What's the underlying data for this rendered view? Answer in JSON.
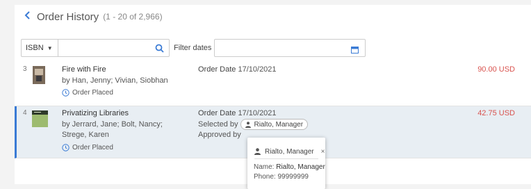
{
  "header": {
    "title": "Order History",
    "count": "(1 - 20 of 2,966)"
  },
  "filter": {
    "field_select": "ISBN",
    "search_value": "",
    "date_label": "Filter dates",
    "date_value": ""
  },
  "orders": [
    {
      "index": "3",
      "title": "Fire with Fire",
      "authors": "by Han, Jenny; Vivian, Siobhan",
      "status": "Order Placed",
      "order_date_label": "Order Date",
      "order_date": "17/10/2021",
      "price": "90.00 USD"
    },
    {
      "index": "4",
      "title": "Privatizing Libraries",
      "authors": "by Jerrard, Jane; Bolt, Nancy; Strege, Karen",
      "status": "Order Placed",
      "order_date_label": "Order Date",
      "order_date": "17/10/2021",
      "selected_by_label": "Selected by",
      "selected_by": "Rialto, Manager",
      "approved_by_label": "Approved by",
      "price": "42.75 USD"
    }
  ],
  "popup": {
    "name_header": "Rialto, Manager",
    "close": "×",
    "name_label": "Name:",
    "name_value": "Rialto, Manager",
    "phone_label": "Phone:",
    "phone_value": "99999999"
  },
  "colors": {
    "accent": "#3a7bd5",
    "price": "#d9534f",
    "selected_row": "#e8eef3"
  },
  "icons": [
    "chevron-left-icon",
    "search-icon",
    "calendar-icon",
    "clock-icon",
    "person-icon",
    "close-icon"
  ]
}
